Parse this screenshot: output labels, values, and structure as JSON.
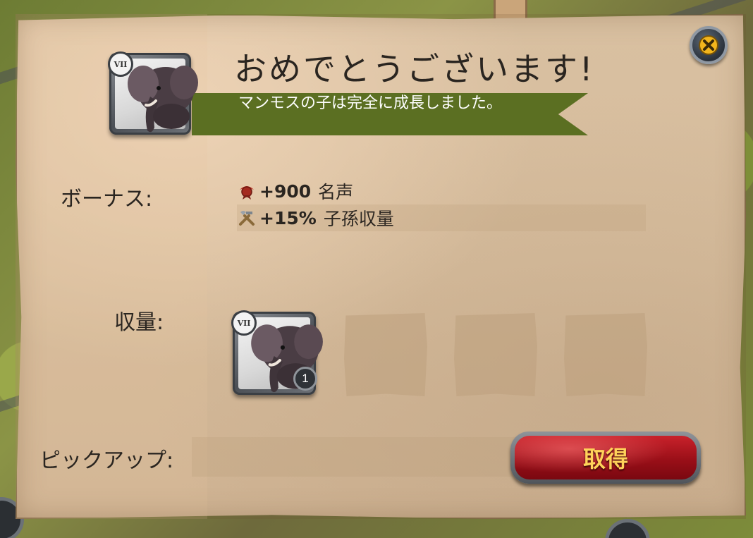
{
  "dialog": {
    "title": "おめでとうございます!",
    "subtitle": "マンモスの子は完全に成長しました。",
    "tier": "VII"
  },
  "bonus": {
    "label": "ボーナス:",
    "items": [
      {
        "icon": "fame-icon",
        "value": "+900",
        "text": "名声"
      },
      {
        "icon": "tools-icon",
        "value": "+15%",
        "text": "子孫収量"
      }
    ]
  },
  "yield": {
    "label": "収量:",
    "items": [
      {
        "name": "mammoth-calf",
        "tier": "VII",
        "count": "1"
      }
    ],
    "empty_slots": 3
  },
  "pickup": {
    "label": "ピックアップ:"
  },
  "buttons": {
    "claim": "取得",
    "close": "close-icon"
  },
  "colors": {
    "ribbon": "#5b6f22",
    "parchment": "#d6bc9c",
    "claim_button": "#b3161f",
    "claim_text": "#ffd25a"
  }
}
